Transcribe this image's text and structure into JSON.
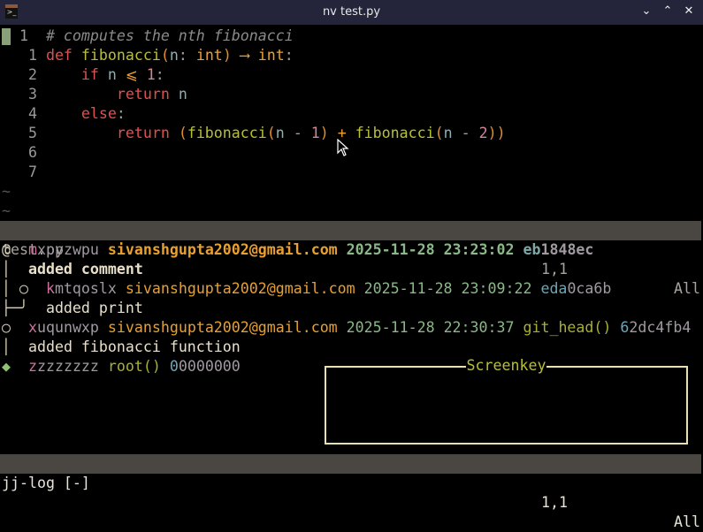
{
  "window": {
    "title": "nv test.py",
    "controls": [
      "minimize",
      "maximize",
      "close"
    ]
  },
  "editor": {
    "lines": [
      {
        "num": "1",
        "abs": true,
        "tokens": [
          [
            "# computes the nth fibonacci",
            "c-comment"
          ]
        ]
      },
      {
        "num": "1",
        "tokens": [
          [
            "def ",
            "c-kw"
          ],
          [
            "fibonacci",
            "c-fn"
          ],
          [
            "(",
            "c-paren"
          ],
          [
            "n",
            "c-var"
          ],
          [
            ": ",
            "c-op"
          ],
          [
            "int",
            "c-type"
          ],
          [
            ") ",
            "c-paren"
          ],
          [
            "⟶ ",
            "c-type"
          ],
          [
            "int",
            "c-type"
          ],
          [
            ":",
            "c-op"
          ]
        ]
      },
      {
        "num": "2",
        "tokens": [
          [
            "    ",
            " "
          ],
          [
            "if ",
            "c-kw"
          ],
          [
            "n ",
            "c-var"
          ],
          [
            "⩽ ",
            "c-type"
          ],
          [
            "1",
            "c-num"
          ],
          [
            ":",
            "c-op"
          ]
        ]
      },
      {
        "num": "3",
        "tokens": [
          [
            "        ",
            ""
          ],
          [
            "return ",
            "c-kw"
          ],
          [
            "n",
            "c-var"
          ]
        ]
      },
      {
        "num": "4",
        "tokens": [
          [
            "    ",
            ""
          ],
          [
            "else",
            "c-kw"
          ],
          [
            ":",
            "c-op"
          ]
        ]
      },
      {
        "num": "5",
        "tokens": [
          [
            "        ",
            ""
          ],
          [
            "return ",
            "c-kw"
          ],
          [
            "(",
            "c-paren"
          ],
          [
            "fibonacci",
            "c-fn"
          ],
          [
            "(",
            "c-paren"
          ],
          [
            "n ",
            "c-var"
          ],
          [
            "- ",
            "c-op"
          ],
          [
            "1",
            "c-num"
          ],
          [
            ") ",
            "c-paren"
          ],
          [
            "+ ",
            "c-type"
          ],
          [
            "fibonacci",
            "c-fn"
          ],
          [
            "(",
            "c-paren"
          ],
          [
            "n ",
            "c-var"
          ],
          [
            "- ",
            "c-op"
          ],
          [
            "2",
            "c-num"
          ],
          [
            "))",
            "c-paren"
          ]
        ]
      },
      {
        "num": "6",
        "tokens": []
      },
      {
        "num": "7",
        "tokens": []
      }
    ],
    "empty_marker": "~",
    "status": {
      "filename": "test.py",
      "position": "1,1",
      "scroll": "All"
    }
  },
  "jjlog": {
    "lines": [
      [
        [
          "@",
          "c-graph"
        ],
        [
          "  ",
          ""
        ],
        [
          "m",
          "c-id1"
        ],
        [
          "xppzwpu ",
          "c-idr"
        ],
        [
          "sivanshgupta2002@gmail.com ",
          "c-email bold"
        ],
        [
          "2025-11-28 23:23:02 ",
          "c-date bold"
        ],
        [
          "eb",
          "c-hash1 bold"
        ],
        [
          "1848ec",
          "c-idr bold"
        ]
      ],
      [
        [
          "│ ",
          "c-graph"
        ],
        [
          " added comment",
          "c-msg bold"
        ]
      ],
      [
        [
          "│ ○  ",
          "c-graph"
        ],
        [
          "k",
          "c-id1"
        ],
        [
          "mtqoslx ",
          "c-idr"
        ],
        [
          "sivanshgupta2002@gmail.com ",
          "c-email"
        ],
        [
          "2025-11-28 23:09:22 ",
          "c-date"
        ],
        [
          "eda",
          "c-hash2"
        ],
        [
          "0ca6b",
          "c-idr"
        ]
      ],
      [
        [
          "├─╯  ",
          "c-graph"
        ],
        [
          "added print",
          "c-msg"
        ]
      ],
      [
        [
          "○  ",
          "c-graph"
        ],
        [
          "x",
          "c-id1"
        ],
        [
          "uqunwxp ",
          "c-idr"
        ],
        [
          "sivanshgupta2002@gmail.com ",
          "c-email"
        ],
        [
          "2025-11-28 22:30:37 ",
          "c-date"
        ],
        [
          "git_head() ",
          "c-ref"
        ],
        [
          "6",
          "c-hash2"
        ],
        [
          "2dc4fb4",
          "c-idr"
        ]
      ],
      [
        [
          "│  ",
          "c-graph"
        ],
        [
          "added fibonacci function",
          "c-msg"
        ]
      ],
      [
        [
          "◆  ",
          "c-diamond"
        ],
        [
          "z",
          "c-id1"
        ],
        [
          "zzzzzzz ",
          "c-idr"
        ],
        [
          "root() ",
          "c-ref"
        ],
        [
          "0",
          "c-hash2"
        ],
        [
          "0000000",
          "c-idr"
        ]
      ]
    ],
    "status": {
      "filename": "jj-log [-]",
      "position": "1,1",
      "scroll": "All"
    }
  },
  "screenkey": {
    "title": "Screenkey"
  }
}
